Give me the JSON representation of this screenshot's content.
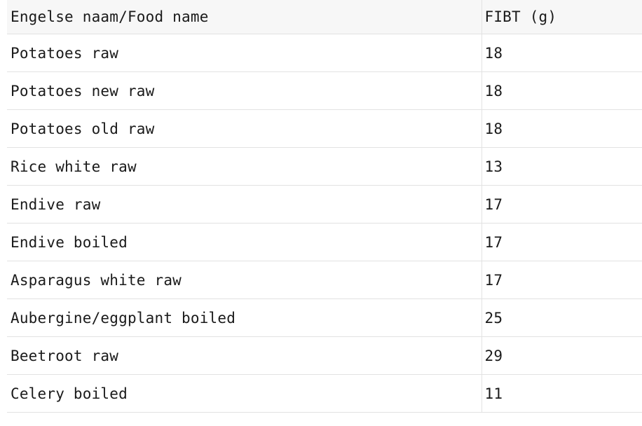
{
  "table": {
    "headers": [
      "Engelse naam/Food name",
      "FIBT (g)"
    ],
    "rows": [
      {
        "name": "Potatoes raw",
        "value": "18"
      },
      {
        "name": "Potatoes new raw",
        "value": "18"
      },
      {
        "name": "Potatoes old raw",
        "value": "18"
      },
      {
        "name": "Rice white raw",
        "value": "13"
      },
      {
        "name": "Endive raw",
        "value": "17"
      },
      {
        "name": "Endive boiled",
        "value": "17"
      },
      {
        "name": "Asparagus white raw",
        "value": "17"
      },
      {
        "name": "Aubergine/eggplant boiled",
        "value": "25"
      },
      {
        "name": "Beetroot raw",
        "value": "29"
      },
      {
        "name": "Celery boiled",
        "value": "11"
      }
    ]
  }
}
